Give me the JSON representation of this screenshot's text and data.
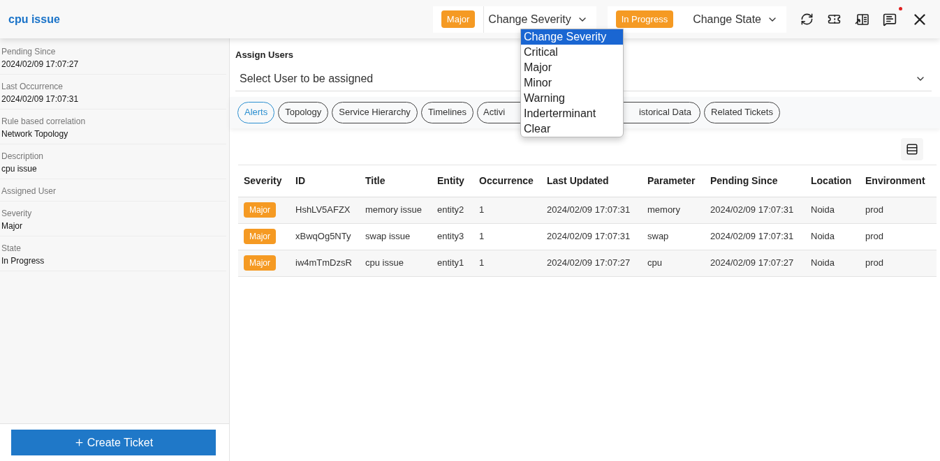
{
  "header": {
    "title": "cpu issue",
    "severity_badge": "Major",
    "severity_select": "Change Severity",
    "state_badge": "In Progress",
    "state_select": "Change State",
    "has_notification": true
  },
  "severity_dropdown": {
    "options": [
      {
        "label": "Change Severity",
        "selected": true
      },
      {
        "label": "Critical",
        "selected": false
      },
      {
        "label": "Major",
        "selected": false
      },
      {
        "label": "Minor",
        "selected": false
      },
      {
        "label": "Warning",
        "selected": false
      },
      {
        "label": "Inderterminant",
        "selected": false
      },
      {
        "label": "Clear",
        "selected": false
      }
    ]
  },
  "sidebar": {
    "fields": [
      {
        "label": "Pending Since",
        "value": "2024/02/09 17:07:27"
      },
      {
        "label": "Last Occurrence",
        "value": "2024/02/09 17:07:31"
      },
      {
        "label": "Rule based correlation",
        "value": "Network Topology"
      },
      {
        "label": "Description",
        "value": "cpu issue"
      },
      {
        "label": "Assigned User"
      },
      {
        "label": "Severity",
        "value": "Major"
      },
      {
        "label": "State",
        "value": "In Progress"
      }
    ],
    "create_button": "Create Ticket"
  },
  "assign_users": {
    "title": "Assign Users",
    "placeholder": "Select User to be assigned"
  },
  "tabs": [
    {
      "label": "Alerts",
      "selected": true
    },
    {
      "label": "Topology",
      "selected": false
    },
    {
      "label": "Service Hierarchy",
      "selected": false
    },
    {
      "label": "Timelines",
      "selected": false
    },
    {
      "label": "Activi",
      "selected": false,
      "kind": "covered-right"
    },
    {
      "label": "istorical Data",
      "selected": false,
      "kind": "covered-left"
    },
    {
      "label": "Related Tickets",
      "selected": false
    }
  ],
  "table": {
    "columns": [
      "Severity",
      "ID",
      "Title",
      "Entity",
      "Occurrence",
      "Last Updated",
      "Parameter",
      "Pending Since",
      "Location",
      "Environment"
    ],
    "rows": [
      {
        "cells": [
          "Major",
          "HshLV5AFZX",
          "memory issue",
          "entity2",
          "1",
          "2024/02/09 17:07:31",
          "memory",
          "2024/02/09 17:07:31",
          "Noida",
          "prod"
        ]
      },
      {
        "cells": [
          "Major",
          "xBwqOg5NTy",
          "swap issue",
          "entity3",
          "1",
          "2024/02/09 17:07:31",
          "swap",
          "2024/02/09 17:07:31",
          "Noida",
          "prod"
        ]
      },
      {
        "cells": [
          "Major",
          "iw4mTmDzsR",
          "cpu issue",
          "entity1",
          "1",
          "2024/02/09 17:07:27",
          "cpu",
          "2024/02/09 17:07:27",
          "Noida",
          "prod"
        ]
      }
    ]
  }
}
